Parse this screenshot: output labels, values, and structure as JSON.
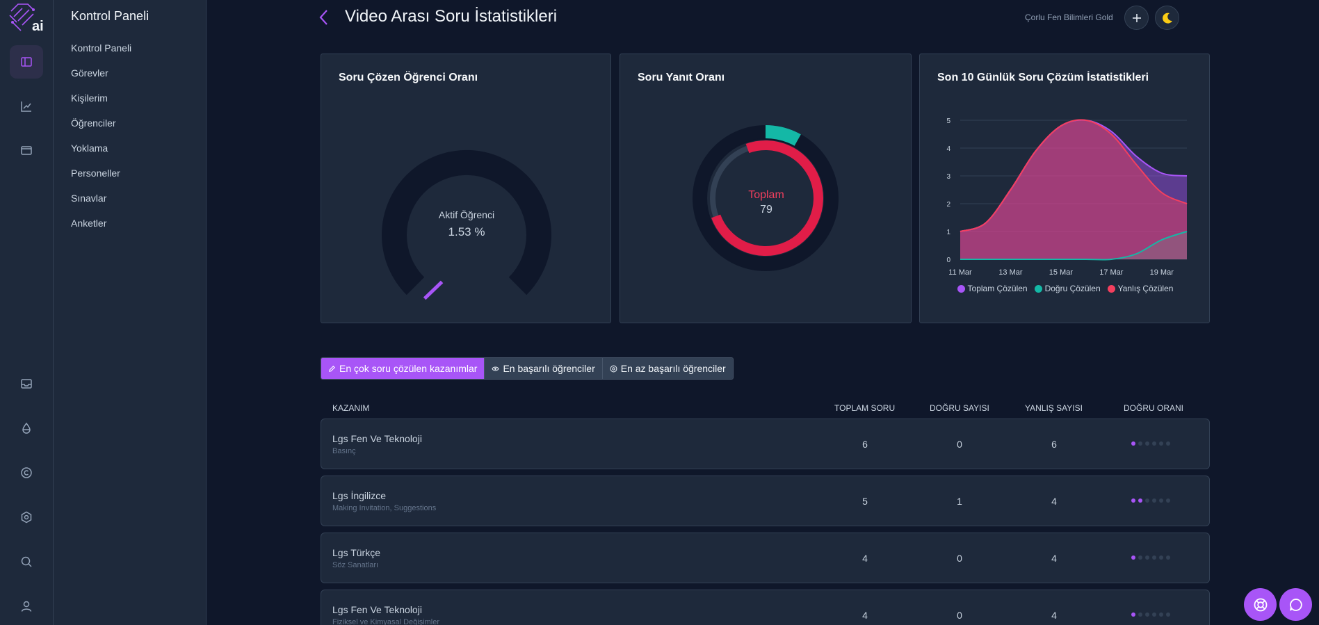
{
  "brand": {
    "logo_text": "ai",
    "accent": "#a855f7"
  },
  "rail": {
    "items": [
      {
        "name": "panel-icon",
        "active": true
      },
      {
        "name": "chart-icon",
        "active": false
      },
      {
        "name": "wallet-icon",
        "active": false
      },
      {
        "name": "inbox-icon",
        "active": false
      },
      {
        "name": "drop-icon",
        "active": false
      },
      {
        "name": "copyright-icon",
        "active": false
      },
      {
        "name": "settings-icon",
        "active": false
      },
      {
        "name": "search-icon",
        "active": false
      },
      {
        "name": "user-icon",
        "active": false
      }
    ]
  },
  "nav": {
    "title": "Kontrol Paneli",
    "items": [
      "Kontrol Paneli",
      "Görevler",
      "Kişilerim",
      "Öğrenciler",
      "Yoklama",
      "Personeller",
      "Sınavlar",
      "Anketler"
    ]
  },
  "header": {
    "title": "Video Arası Soru İstatistikleri",
    "org": "Çorlu Fen Bilimleri Gold"
  },
  "cards": {
    "gauge": {
      "title": "Soru Çözen Öğrenci Oranı",
      "label": "Aktif Öğrenci",
      "value_text": "1.53 %",
      "value": 1.53,
      "color": "#a855f7"
    },
    "donut": {
      "title": "Soru Yanıt Oranı",
      "label": "Toplam",
      "total": "79",
      "correct_color": "#14b8a6",
      "wrong_color": "#e11d48"
    },
    "area": {
      "title": "Son 10 Günlük Soru Çözüm İstatistikleri"
    }
  },
  "chart_data": {
    "type": "area",
    "categories": [
      "11 Mar",
      "12 Mar",
      "13 Mar",
      "14 Mar",
      "15 Mar",
      "16 Mar",
      "17 Mar",
      "18 Mar",
      "19 Mar",
      "20 Mar"
    ],
    "x_ticks": [
      "11 Mar",
      "13 Mar",
      "15 Mar",
      "17 Mar",
      "19 Mar"
    ],
    "y_ticks": [
      "0",
      "1",
      "2",
      "3",
      "4",
      "5"
    ],
    "ylim": [
      0,
      5
    ],
    "series": [
      {
        "name": "Toplam Çözülen",
        "color": "#a855f7",
        "values": [
          1,
          1.3,
          2.5,
          3.9,
          4.8,
          5,
          4.6,
          3.7,
          3.1,
          3
        ]
      },
      {
        "name": "Doğru Çözülen",
        "color": "#14b8a6",
        "values": [
          0,
          0,
          0,
          0,
          0,
          0,
          0,
          0.2,
          0.7,
          1
        ]
      },
      {
        "name": "Yanlış Çözülen",
        "color": "#f43f5e",
        "values": [
          1,
          1.3,
          2.5,
          3.9,
          4.8,
          5,
          4.5,
          3.4,
          2.4,
          2
        ]
      }
    ],
    "grid": true,
    "legend": "bottom"
  },
  "tabs": [
    {
      "label": "En çok soru çözülen kazanımlar",
      "icon": "pencil-icon",
      "active": true
    },
    {
      "label": "En başarılı öğrenciler",
      "icon": "eye-icon",
      "active": false
    },
    {
      "label": "En az başarılı öğrenciler",
      "icon": "target-icon",
      "active": false
    }
  ],
  "table": {
    "columns": [
      "KAZANIM",
      "TOPLAM SORU",
      "DOĞRU SAYISI",
      "YANLIŞ SAYISI",
      "DOĞRU ORANI"
    ],
    "rows": [
      {
        "name": "Lgs Fen Ve Teknoloji",
        "sub": "Basınç",
        "total": "6",
        "correct": "0",
        "wrong": "6",
        "rating": 1
      },
      {
        "name": "Lgs İngilizce",
        "sub": "Making Invitation, Suggestions",
        "total": "5",
        "correct": "1",
        "wrong": "4",
        "rating": 2
      },
      {
        "name": "Lgs Türkçe",
        "sub": "Söz Sanatları",
        "total": "4",
        "correct": "0",
        "wrong": "4",
        "rating": 1
      },
      {
        "name": "Lgs Fen Ve Teknoloji",
        "sub": "Fiziksel ve Kimyasal Değişimler",
        "total": "4",
        "correct": "0",
        "wrong": "4",
        "rating": 1
      }
    ],
    "rating_max": 6
  },
  "floating": [
    {
      "name": "lifebuoy-icon"
    },
    {
      "name": "chat-icon"
    }
  ]
}
